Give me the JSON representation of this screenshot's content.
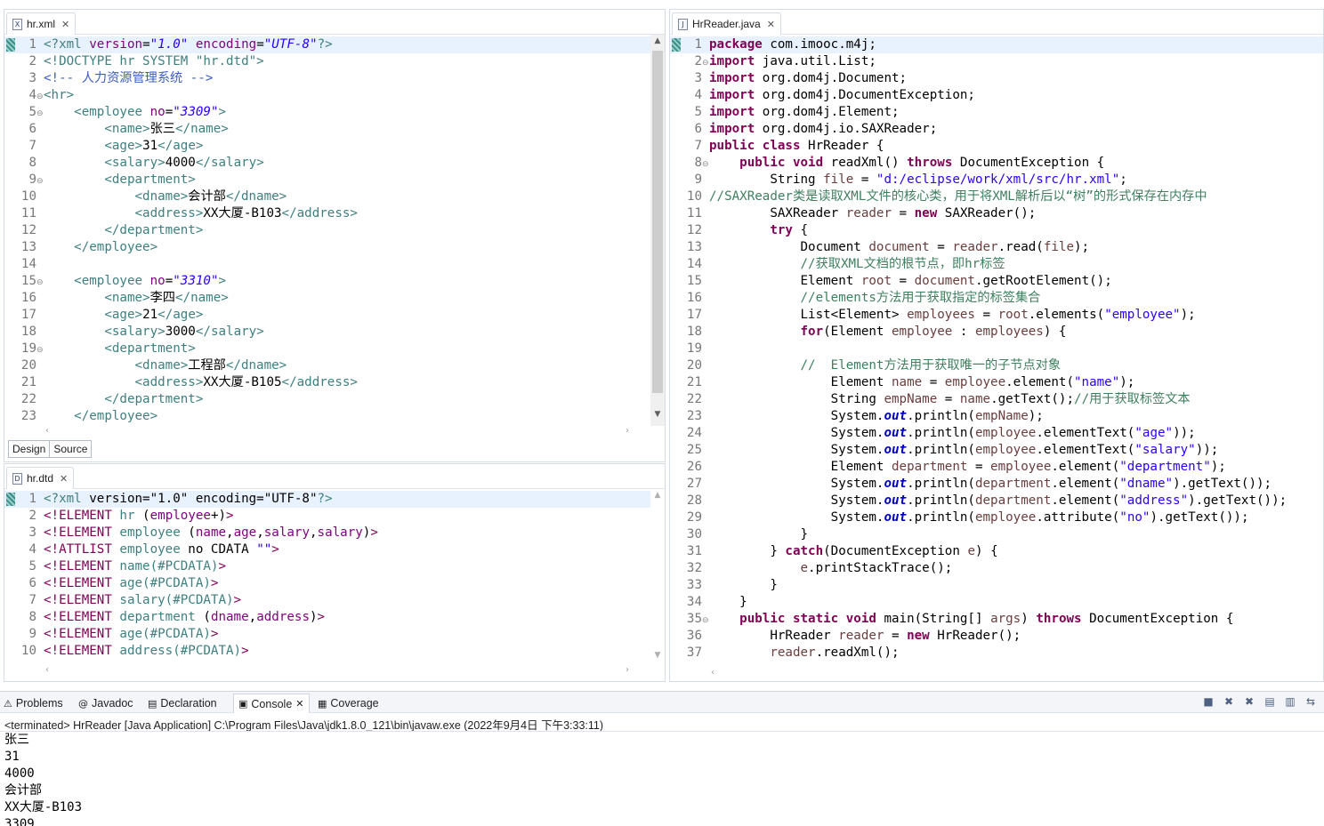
{
  "xml_editor": {
    "tab_label": "hr.xml",
    "file_icon": "xml-file-icon",
    "subtabs": [
      "Design",
      "Source"
    ],
    "lines": [
      {
        "n": "1",
        "fold": false,
        "html": "<span class='t-tag'>&lt;?</span><span class='t-tag'>xml</span> <span class='t-attr'>version</span>=<span class='t-val'>\"1.0\"</span> <span class='t-attr'>encoding</span>=<span class='t-val'>\"UTF-8\"</span><span class='t-tag'>?&gt;</span>"
      },
      {
        "n": "2",
        "fold": false,
        "html": "<span class='t-tag'>&lt;!DOCTYPE hr SYSTEM \"hr.dtd\"&gt;</span>"
      },
      {
        "n": "3",
        "fold": false,
        "html": "<span class='t-com'>&lt;!-- 人力资源管理系统 --&gt;</span>"
      },
      {
        "n": "4",
        "fold": true,
        "html": "<span class='t-tag'>&lt;hr&gt;</span>"
      },
      {
        "n": "5",
        "fold": true,
        "html": "    <span class='t-tag'>&lt;employee</span> <span class='t-attr'>no</span>=<span class='t-val'>\"3309\"</span><span class='t-tag'>&gt;</span>"
      },
      {
        "n": "6",
        "fold": false,
        "html": "        <span class='t-tag'>&lt;name&gt;</span>张三<span class='t-tag'>&lt;/name&gt;</span>"
      },
      {
        "n": "7",
        "fold": false,
        "html": "        <span class='t-tag'>&lt;age&gt;</span>31<span class='t-tag'>&lt;/age&gt;</span>"
      },
      {
        "n": "8",
        "fold": false,
        "html": "        <span class='t-tag'>&lt;salary&gt;</span>4000<span class='t-tag'>&lt;/salary&gt;</span>"
      },
      {
        "n": "9",
        "fold": true,
        "html": "        <span class='t-tag'>&lt;department&gt;</span>"
      },
      {
        "n": "10",
        "fold": false,
        "html": "            <span class='t-tag'>&lt;dname&gt;</span>会计部<span class='t-tag'>&lt;/dname&gt;</span>"
      },
      {
        "n": "11",
        "fold": false,
        "html": "            <span class='t-tag'>&lt;address&gt;</span>XX大厦-B103<span class='t-tag'>&lt;/address&gt;</span>"
      },
      {
        "n": "12",
        "fold": false,
        "html": "        <span class='t-tag'>&lt;/department&gt;</span>"
      },
      {
        "n": "13",
        "fold": false,
        "html": "    <span class='t-tag'>&lt;/employee&gt;</span>"
      },
      {
        "n": "14",
        "fold": false,
        "html": ""
      },
      {
        "n": "15",
        "fold": true,
        "html": "    <span class='t-tag'>&lt;employee</span> <span class='t-attr'>no</span>=<span class='t-val'>\"3310\"</span><span class='t-tag'>&gt;</span>"
      },
      {
        "n": "16",
        "fold": false,
        "html": "        <span class='t-tag'>&lt;name&gt;</span>李四<span class='t-tag'>&lt;/name&gt;</span>"
      },
      {
        "n": "17",
        "fold": false,
        "html": "        <span class='t-tag'>&lt;age&gt;</span>21<span class='t-tag'>&lt;/age&gt;</span>"
      },
      {
        "n": "18",
        "fold": false,
        "html": "        <span class='t-tag'>&lt;salary&gt;</span>3000<span class='t-tag'>&lt;/salary&gt;</span>"
      },
      {
        "n": "19",
        "fold": true,
        "html": "        <span class='t-tag'>&lt;department&gt;</span>"
      },
      {
        "n": "20",
        "fold": false,
        "html": "            <span class='t-tag'>&lt;dname&gt;</span>工程部<span class='t-tag'>&lt;/dname&gt;</span>"
      },
      {
        "n": "21",
        "fold": false,
        "html": "            <span class='t-tag'>&lt;address&gt;</span>XX大厦-B105<span class='t-tag'>&lt;/address&gt;</span>"
      },
      {
        "n": "22",
        "fold": false,
        "html": "        <span class='t-tag'>&lt;/department&gt;</span>"
      },
      {
        "n": "23",
        "fold": false,
        "html": "    <span class='t-tag'>&lt;/employee&gt;</span>"
      }
    ]
  },
  "dtd_editor": {
    "tab_label": "hr.dtd",
    "file_icon": "dtd-file-icon",
    "lines": [
      {
        "n": "1",
        "fold": false,
        "html": "<span class='t-tag'>&lt;?</span><span class='t-tag'>xml</span> version=\"1.0\" encoding=\"UTF-8\"<span class='t-tag'>?&gt;</span>"
      },
      {
        "n": "2",
        "fold": false,
        "html": "<span class='t-dtd'>&lt;!ELEMENT</span> <span class='t-elem'>hr</span> (<span class='t-attr'>employee</span>+)<span class='t-dtd'>&gt;</span>"
      },
      {
        "n": "3",
        "fold": false,
        "html": "<span class='t-dtd'>&lt;!ELEMENT</span> <span class='t-elem'>employee</span> (<span class='t-attr'>name</span>,<span class='t-attr'>age</span>,<span class='t-attr'>salary</span>,<span class='t-attr'>salary</span>)<span class='t-dtd'>&gt;</span>"
      },
      {
        "n": "4",
        "fold": false,
        "html": "<span class='t-dtd'>&lt;!ATTLIST</span> <span class='t-elem'>employee</span> no CDATA <span class='t-str'>\"\"</span><span class='t-dtd'>&gt;</span>"
      },
      {
        "n": "5",
        "fold": false,
        "html": "<span class='t-dtd'>&lt;!ELEMENT</span> <span class='t-elem'>name(#PCDATA)</span><span class='t-dtd'>&gt;</span>"
      },
      {
        "n": "6",
        "fold": false,
        "html": "<span class='t-dtd'>&lt;!ELEMENT</span> <span class='t-elem'>age(#PCDATA)</span><span class='t-dtd'>&gt;</span>"
      },
      {
        "n": "7",
        "fold": false,
        "html": "<span class='t-dtd'>&lt;!ELEMENT</span> <span class='t-elem'>salary(#PCDATA)</span><span class='t-dtd'>&gt;</span>"
      },
      {
        "n": "8",
        "fold": false,
        "html": "<span class='t-dtd'>&lt;!ELEMENT</span> <span class='t-elem'>department</span> (<span class='t-attr'>dname</span>,<span class='t-attr'>address</span>)<span class='t-dtd'>&gt;</span>"
      },
      {
        "n": "9",
        "fold": false,
        "html": "<span class='t-dtd'>&lt;!ELEMENT</span> <span class='t-elem'>age(#PCDATA)</span><span class='t-dtd'>&gt;</span>"
      },
      {
        "n": "10",
        "fold": false,
        "html": "<span class='t-dtd'>&lt;!ELEMENT</span> <span class='t-elem'>address(#PCDATA)</span><span class='t-dtd'>&gt;</span>"
      }
    ]
  },
  "java_editor": {
    "tab_label": "HrReader.java",
    "file_icon": "java-file-icon",
    "lines": [
      {
        "n": "1",
        "fold": false,
        "html": "<span class='t-kw'>package</span> com.imooc.m4j;"
      },
      {
        "n": "2",
        "fold": true,
        "html": "<span class='t-kw'>import</span> java.util.List;"
      },
      {
        "n": "3",
        "fold": false,
        "html": "<span class='t-kw'>import</span> org.dom4j.Document;"
      },
      {
        "n": "4",
        "fold": false,
        "html": "<span class='t-kw'>import</span> org.dom4j.DocumentException;"
      },
      {
        "n": "5",
        "fold": false,
        "html": "<span class='t-kw'>import</span> org.dom4j.Element;"
      },
      {
        "n": "6",
        "fold": false,
        "html": "<span class='t-kw'>import</span> org.dom4j.io.SAXReader;"
      },
      {
        "n": "7",
        "fold": false,
        "html": "<span class='t-kw'>public</span> <span class='t-kw'>class</span> HrReader {"
      },
      {
        "n": "8",
        "fold": true,
        "html": "    <span class='t-kw'>public</span> <span class='t-kw'>void</span> readXml() <span class='t-kw'>throws</span> DocumentException {"
      },
      {
        "n": "9",
        "fold": false,
        "html": "        String <span class='t-var'>file</span> = <span class='t-str'>\"d:/eclipse/work/xml/src/hr.xml\"</span>;"
      },
      {
        "n": "10",
        "fold": false,
        "html": "<span class='t-jcom'>//SAXReader类是读取XML文件的核心类，用于将XML解析后以“树”的形式保存在内存中</span>"
      },
      {
        "n": "11",
        "fold": false,
        "html": "        SAXReader <span class='t-var'>reader</span> = <span class='t-kw'>new</span> SAXReader();"
      },
      {
        "n": "12",
        "fold": false,
        "html": "        <span class='t-kw'>try</span> {"
      },
      {
        "n": "13",
        "fold": false,
        "html": "            Document <span class='t-var'>document</span> = <span class='t-var'>reader</span>.read(<span class='t-var'>file</span>);"
      },
      {
        "n": "14",
        "fold": false,
        "html": "            <span class='t-jcom'>//获取XML文档的根节点，即hr标签</span>"
      },
      {
        "n": "15",
        "fold": false,
        "html": "            Element <span class='t-var'>root</span> = <span class='t-var'>document</span>.getRootElement();"
      },
      {
        "n": "16",
        "fold": false,
        "html": "            <span class='t-jcom'>//elements方法用于获取指定的标签集合</span>"
      },
      {
        "n": "17",
        "fold": false,
        "html": "            List&lt;Element&gt; <span class='t-var'>employees</span> = <span class='t-var'>root</span>.elements(<span class='t-str'>\"employee\"</span>);"
      },
      {
        "n": "18",
        "fold": false,
        "html": "            <span class='t-kw'>for</span>(Element <span class='t-var'>employee</span> : <span class='t-var'>employees</span>) {"
      },
      {
        "n": "19",
        "fold": false,
        "html": ""
      },
      {
        "n": "20",
        "fold": false,
        "html": "            <span class='t-jcom'>//  Element方法用于获取唯一的子节点对象</span>"
      },
      {
        "n": "21",
        "fold": false,
        "html": "                Element <span class='t-var'>name</span> = <span class='t-var'>employee</span>.element(<span class='t-str'>\"name\"</span>);"
      },
      {
        "n": "22",
        "fold": false,
        "html": "                String <span class='t-var'>empName</span> = <span class='t-var'>name</span>.getText();<span class='t-jcom'>//用于获取标签文本</span>"
      },
      {
        "n": "23",
        "fold": false,
        "html": "                System.<span class='t-fld'>out</span>.println(<span class='t-var'>empName</span>);"
      },
      {
        "n": "24",
        "fold": false,
        "html": "                System.<span class='t-fld'>out</span>.println(<span class='t-var'>employee</span>.elementText(<span class='t-str'>\"age\"</span>));"
      },
      {
        "n": "25",
        "fold": false,
        "html": "                System.<span class='t-fld'>out</span>.println(<span class='t-var'>employee</span>.elementText(<span class='t-str'>\"salary\"</span>));"
      },
      {
        "n": "26",
        "fold": false,
        "html": "                Element <span class='t-var'>department</span> = <span class='t-var'>employee</span>.element(<span class='t-str'>\"department\"</span>);"
      },
      {
        "n": "27",
        "fold": false,
        "html": "                System.<span class='t-fld'>out</span>.println(<span class='t-var'>department</span>.element(<span class='t-str'>\"dname\"</span>).getText());"
      },
      {
        "n": "28",
        "fold": false,
        "html": "                System.<span class='t-fld'>out</span>.println(<span class='t-var'>department</span>.element(<span class='t-str'>\"address\"</span>).getText());"
      },
      {
        "n": "29",
        "fold": false,
        "html": "                System.<span class='t-fld'>out</span>.println(<span class='t-var'>employee</span>.attribute(<span class='t-str'>\"no\"</span>).getText());"
      },
      {
        "n": "30",
        "fold": false,
        "html": "            }"
      },
      {
        "n": "31",
        "fold": false,
        "html": "        } <span class='t-kw'>catch</span>(DocumentException <span class='t-var'>e</span>) {"
      },
      {
        "n": "32",
        "fold": false,
        "html": "            <span class='t-var'>e</span>.printStackTrace();"
      },
      {
        "n": "33",
        "fold": false,
        "html": "        }"
      },
      {
        "n": "34",
        "fold": false,
        "html": "    }"
      },
      {
        "n": "35",
        "fold": true,
        "html": "    <span class='t-kw'>public</span> <span class='t-kw'>static</span> <span class='t-kw'>void</span> main(String[] <span class='t-var'>args</span>) <span class='t-kw'>throws</span> DocumentException {"
      },
      {
        "n": "36",
        "fold": false,
        "html": "        HrReader <span class='t-var'>reader</span> = <span class='t-kw'>new</span> HrReader();"
      },
      {
        "n": "37",
        "fold": false,
        "html": "        <span class='t-var'>reader</span>.readXml();"
      }
    ]
  },
  "console": {
    "tabs": [
      {
        "label": "Problems",
        "icon": "problems-icon",
        "glyph": "⚠",
        "active": false
      },
      {
        "label": "Javadoc",
        "icon": "javadoc-icon",
        "glyph": "@",
        "active": false
      },
      {
        "label": "Declaration",
        "icon": "declaration-icon",
        "glyph": "▤",
        "active": false
      },
      {
        "label": "Console",
        "icon": "console-icon",
        "glyph": "▣",
        "active": true
      },
      {
        "label": "Coverage",
        "icon": "coverage-icon",
        "glyph": "▦",
        "active": false
      }
    ],
    "status": "<terminated> HrReader [Java Application] C:\\Program Files\\Java\\jdk1.8.0_121\\bin\\javaw.exe (2022年9月4日 下午3:33:11)",
    "output": [
      "张三",
      "31",
      "4000",
      "会计部",
      "XX大厦-B103",
      "3309"
    ],
    "toolbar_icons": [
      "terminate-icon",
      "remove-launch-icon",
      "remove-all-icon",
      "clear-console-icon",
      "scroll-lock-icon",
      "word-wrap-icon"
    ]
  }
}
